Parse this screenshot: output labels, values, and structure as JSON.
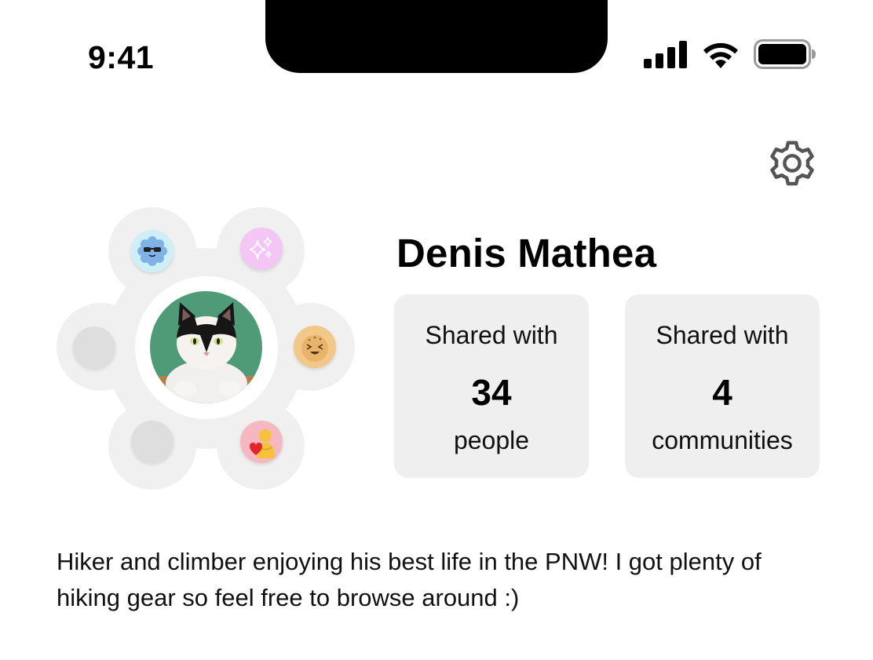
{
  "status_bar": {
    "time": "9:41",
    "icons": [
      "cellular-signal-icon",
      "wifi-icon",
      "battery-icon"
    ]
  },
  "header": {
    "settings_icon": "gear-icon"
  },
  "profile": {
    "name": "Denis Mathea",
    "avatar": "cat-photo",
    "badges": [
      {
        "icon": "blue-sunglasses-badge-icon",
        "color": "#cfeff7"
      },
      {
        "icon": "sparkles-badge-icon",
        "color": "#f3c6f5"
      },
      {
        "icon": "laughing-face-badge-icon",
        "color": "#f1c887"
      },
      {
        "icon": "hug-heart-badge-icon",
        "color": "#f6b8c0"
      }
    ],
    "empty_slot_color": "#dedede"
  },
  "stats": {
    "people": {
      "prefix": "Shared with",
      "count": "34",
      "suffix": "people"
    },
    "communities": {
      "prefix": "Shared with",
      "count": "4",
      "suffix": "communities"
    }
  },
  "bio": "Hiker and climber enjoying his best life in the PNW! I got plenty of hiking gear so feel free to browse around :)",
  "colors": {
    "card_bg": "#efefef",
    "cluster_bg": "#f0f0f0",
    "text": "#000000"
  }
}
